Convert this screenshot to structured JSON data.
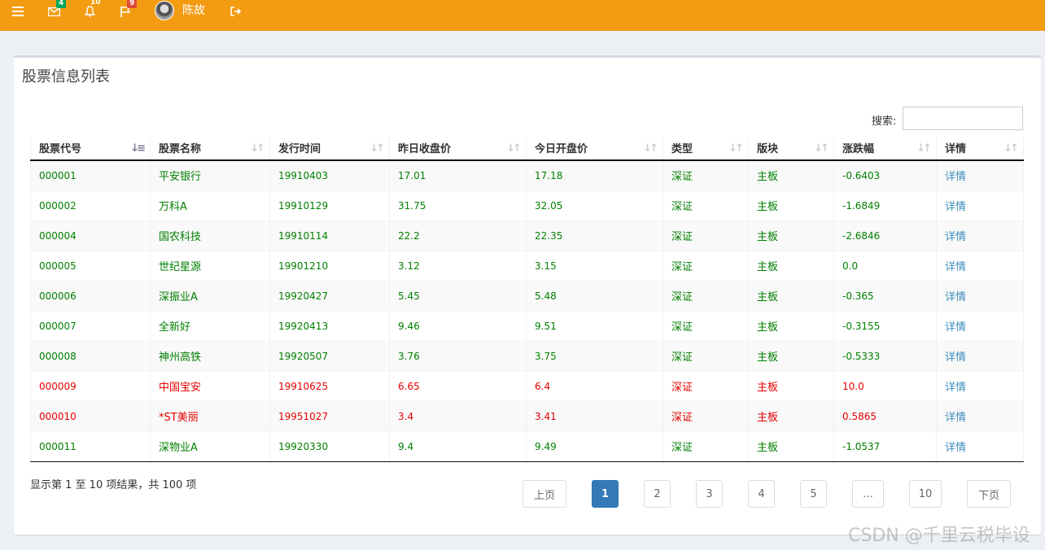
{
  "topbar": {
    "mail_badge": "4",
    "bell_badge": "10",
    "flag_badge": "9",
    "username": "陈故"
  },
  "box": {
    "title": "股票信息列表",
    "search_label": "搜索:",
    "search_value": ""
  },
  "table": {
    "headers": [
      "股票代号",
      "股票名称",
      "发行时间",
      "昨日收盘价",
      "今日开盘价",
      "类型",
      "版块",
      "涨跌幅",
      "详情"
    ],
    "rows": [
      {
        "code": "000001",
        "name": "平安银行",
        "date": "19910403",
        "close": "17.01",
        "open": "17.18",
        "type": "深证",
        "board": "主板",
        "change": "-0.6403",
        "detail": "详情",
        "status": "green"
      },
      {
        "code": "000002",
        "name": "万科A",
        "date": "19910129",
        "close": "31.75",
        "open": "32.05",
        "type": "深证",
        "board": "主板",
        "change": "-1.6849",
        "detail": "详情",
        "status": "green"
      },
      {
        "code": "000004",
        "name": "国农科技",
        "date": "19910114",
        "close": "22.2",
        "open": "22.35",
        "type": "深证",
        "board": "主板",
        "change": "-2.6846",
        "detail": "详情",
        "status": "green"
      },
      {
        "code": "000005",
        "name": "世纪星源",
        "date": "19901210",
        "close": "3.12",
        "open": "3.15",
        "type": "深证",
        "board": "主板",
        "change": "0.0",
        "detail": "详情",
        "status": "green"
      },
      {
        "code": "000006",
        "name": "深振业A",
        "date": "19920427",
        "close": "5.45",
        "open": "5.48",
        "type": "深证",
        "board": "主板",
        "change": "-0.365",
        "detail": "详情",
        "status": "green"
      },
      {
        "code": "000007",
        "name": "全新好",
        "date": "19920413",
        "close": "9.46",
        "open": "9.51",
        "type": "深证",
        "board": "主板",
        "change": "-0.3155",
        "detail": "详情",
        "status": "green"
      },
      {
        "code": "000008",
        "name": "神州高铁",
        "date": "19920507",
        "close": "3.76",
        "open": "3.75",
        "type": "深证",
        "board": "主板",
        "change": "-0.5333",
        "detail": "详情",
        "status": "green"
      },
      {
        "code": "000009",
        "name": "中国宝安",
        "date": "19910625",
        "close": "6.65",
        "open": "6.4",
        "type": "深证",
        "board": "主板",
        "change": "10.0",
        "detail": "详情",
        "status": "red"
      },
      {
        "code": "000010",
        "name": "*ST美丽",
        "date": "19951027",
        "close": "3.4",
        "open": "3.41",
        "type": "深证",
        "board": "主板",
        "change": "0.5865",
        "detail": "详情",
        "status": "red"
      },
      {
        "code": "000011",
        "name": "深物业A",
        "date": "19920330",
        "close": "9.4",
        "open": "9.49",
        "type": "深证",
        "board": "主板",
        "change": "-1.0537",
        "detail": "详情",
        "status": "green"
      }
    ]
  },
  "footer": {
    "info": "显示第 1 至 10 项结果，共 100 项"
  },
  "pagination": {
    "prev": "上页",
    "pages": [
      "1",
      "2",
      "3",
      "4",
      "5",
      "…",
      "10"
    ],
    "active": "1",
    "next": "下页"
  },
  "colors": {
    "topbar": "#f39c12",
    "row_green": "#008000",
    "row_red": "#e60000",
    "link": "#3c8dbc",
    "page_active": "#337ab7"
  },
  "watermark": "CSDN @千里云税毕设"
}
